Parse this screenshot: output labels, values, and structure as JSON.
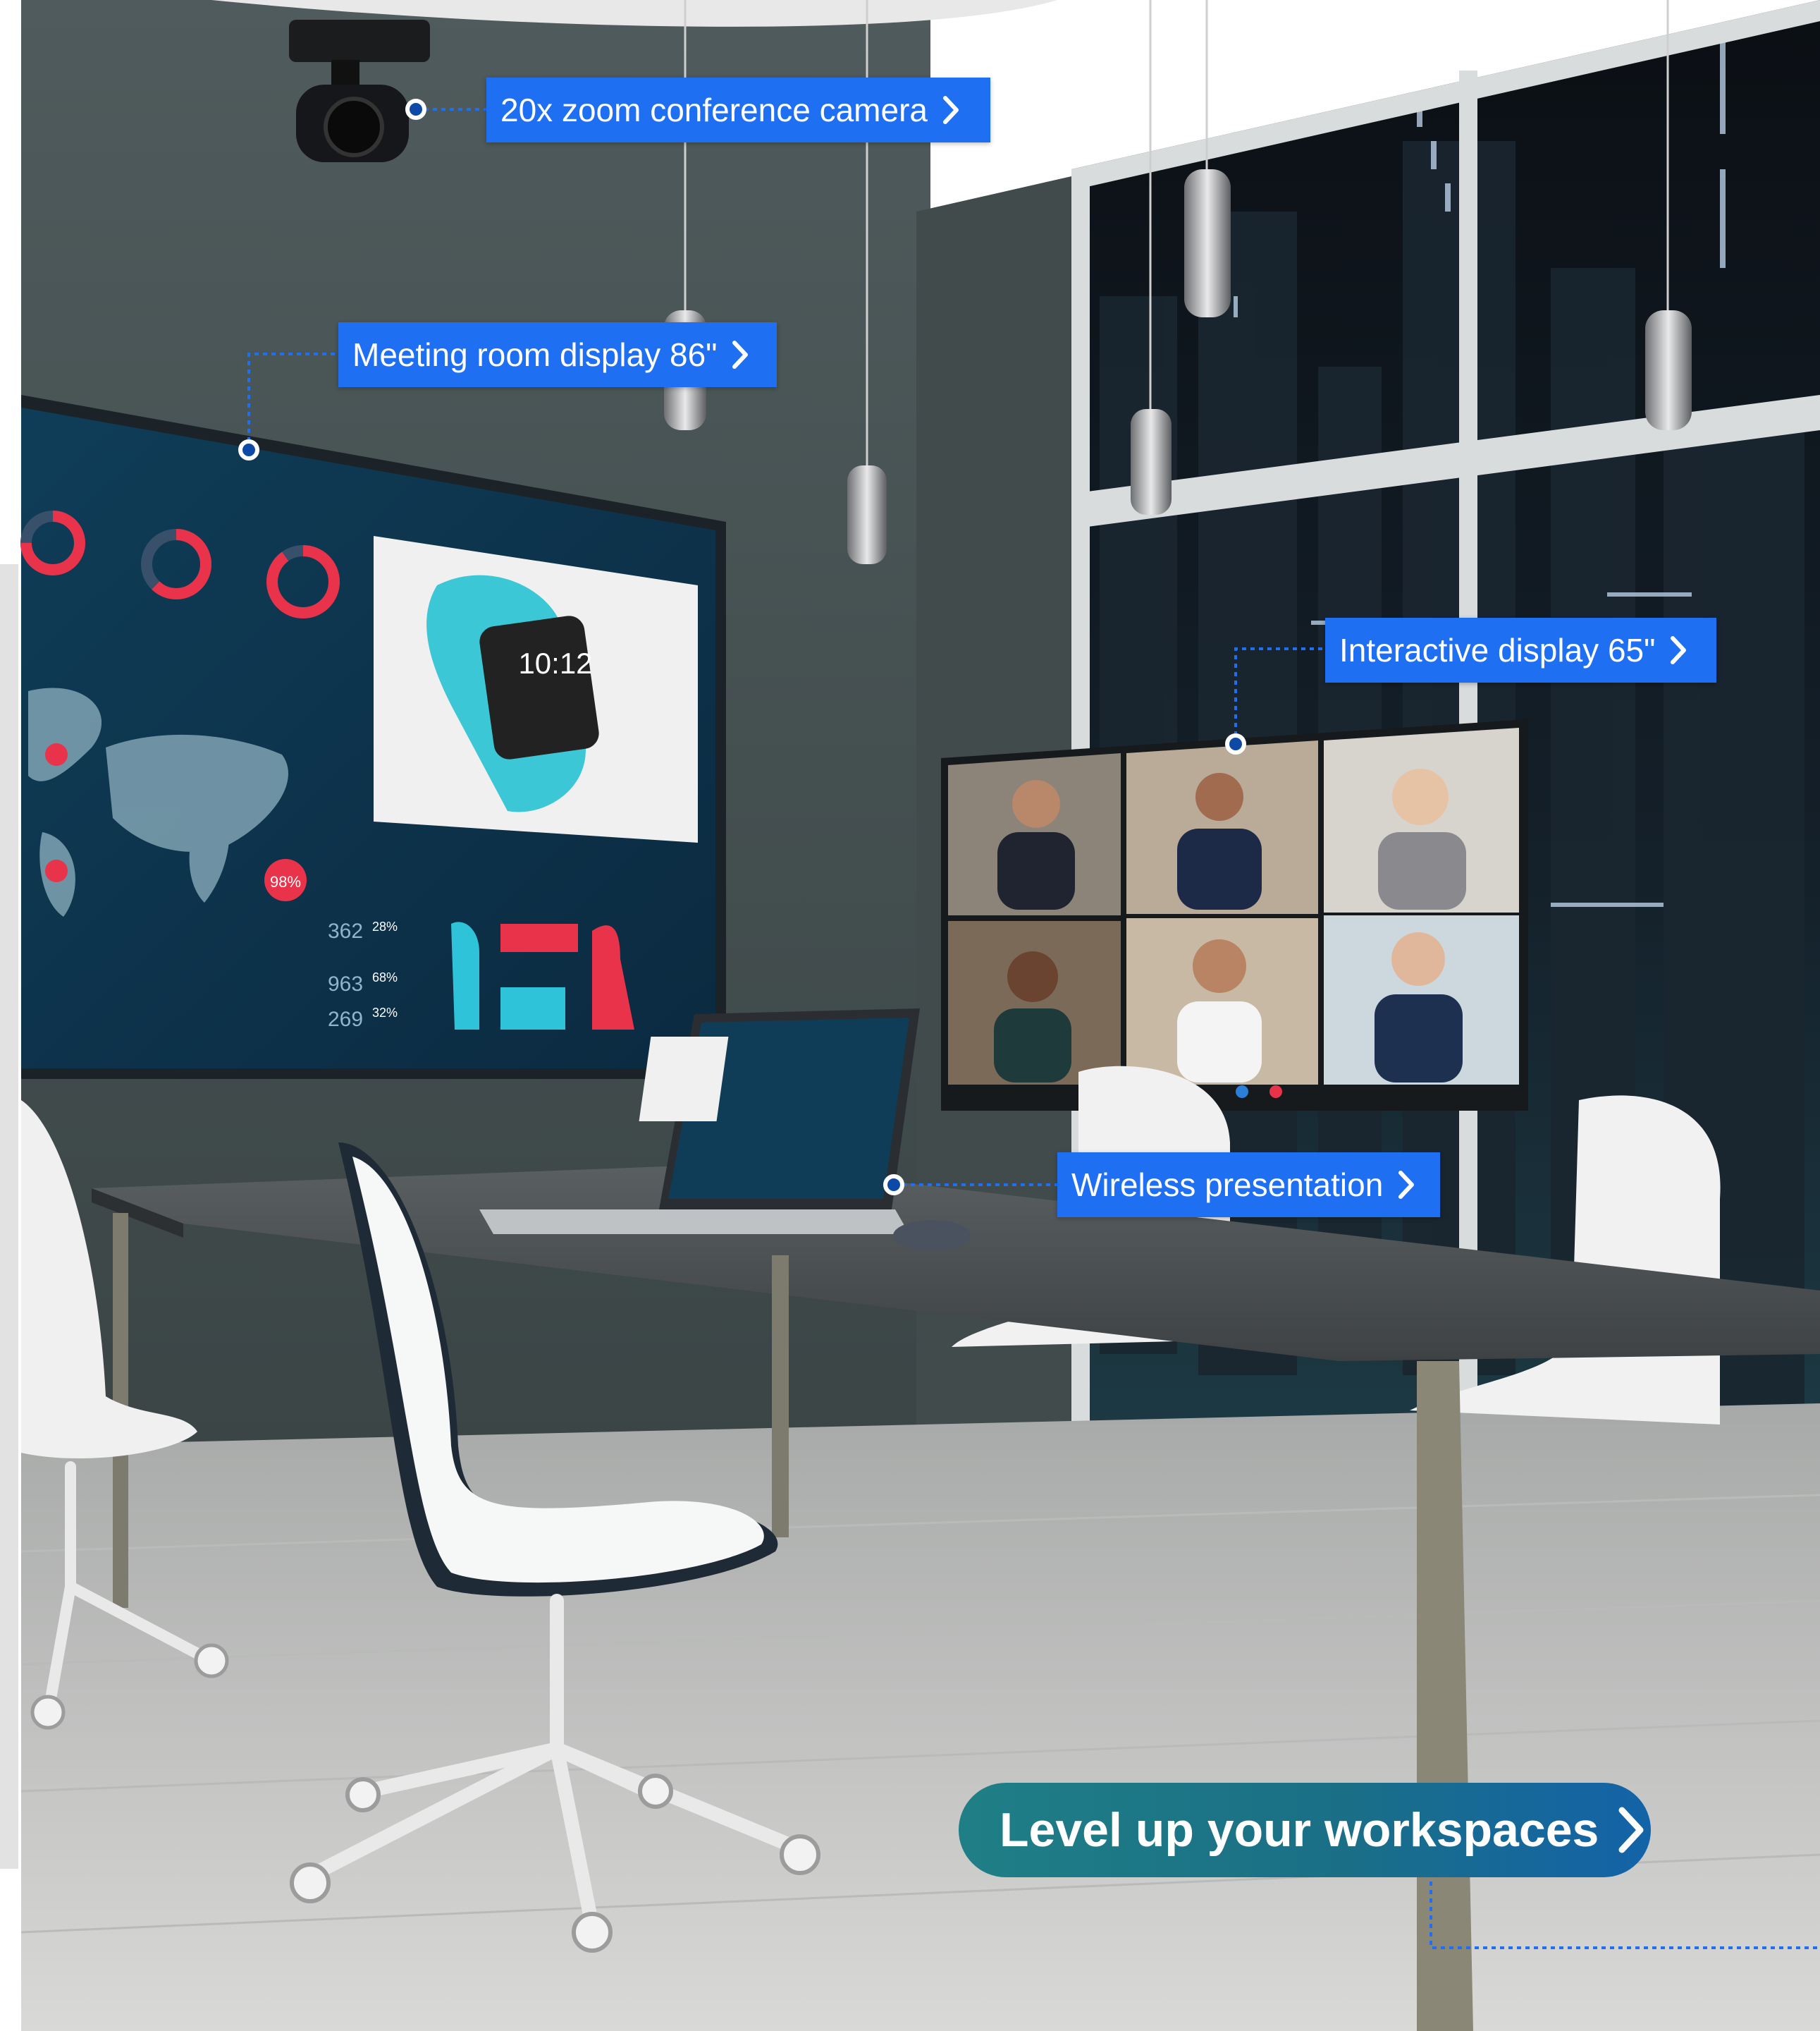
{
  "scene": {
    "image": "conference-room-photo"
  },
  "hotspots": [
    {
      "id": "camera",
      "label": "20x zoom conference camera",
      "icon": "chevron-right-icon"
    },
    {
      "id": "display86",
      "label": "Meeting room display 86\"",
      "icon": "chevron-right-icon"
    },
    {
      "id": "display65",
      "label": "Interactive display 65\"",
      "icon": "chevron-right-icon"
    },
    {
      "id": "wireless",
      "label": "Wireless presentation",
      "icon": "chevron-right-icon"
    }
  ],
  "screen86": {
    "donuts": [
      {
        "label": "75%",
        "percent": 75
      },
      {
        "label": "62%",
        "percent": 62
      },
      {
        "label": "90%",
        "percent": 90
      }
    ],
    "map_badges": [
      "98%"
    ],
    "stats": [
      "362",
      "963",
      "269"
    ],
    "bars": [
      "28%",
      "68%",
      "32%"
    ],
    "watch_time": "10:12"
  },
  "cta": {
    "label": "Level up your workspaces",
    "icon": "chevron-right-icon"
  },
  "colors": {
    "label_bg": "#1f6ff2",
    "dot": "#0d4aa8",
    "cta_from": "#1f7f86",
    "cta_to": "#1363a8"
  }
}
